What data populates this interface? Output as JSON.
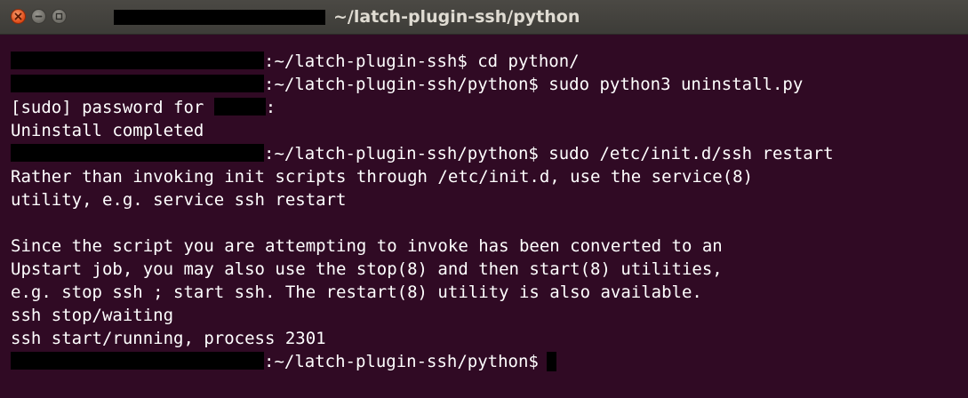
{
  "window": {
    "title": "~/latch-plugin-ssh/python",
    "controls": {
      "close": "close-icon",
      "minimize": "minimize-icon",
      "maximize": "maximize-icon"
    }
  },
  "terminal": {
    "background": "#300a24",
    "foreground": "#ffffff",
    "lines": [
      ":~/latch-plugin-ssh$ cd python/",
      ":~/latch-plugin-ssh/python$ sudo python3 uninstall.py",
      "[sudo] password for ",
      ":",
      "Uninstall completed",
      ":~/latch-plugin-ssh/python$ sudo /etc/init.d/ssh restart",
      "Rather than invoking init scripts through /etc/init.d, use the service(8)",
      "utility, e.g. service ssh restart",
      "",
      "Since the script you are attempting to invoke has been converted to an",
      "Upstart job, you may also use the stop(8) and then start(8) utilities,",
      "e.g. stop ssh ; start ssh. The restart(8) utility is also available.",
      "ssh stop/waiting",
      "ssh start/running, process 2301",
      ":~/latch-plugin-ssh/python$"
    ]
  }
}
